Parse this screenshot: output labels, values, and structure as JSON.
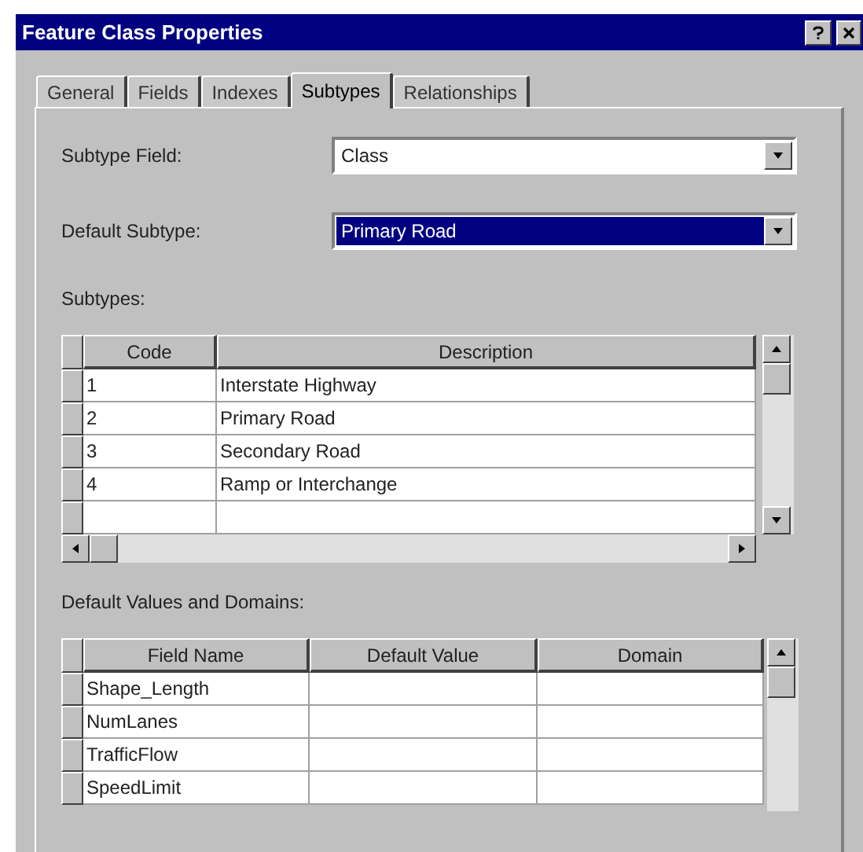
{
  "window": {
    "title": "Feature Class Properties"
  },
  "tabs": [
    {
      "label": "General",
      "selected": false
    },
    {
      "label": "Fields",
      "selected": false
    },
    {
      "label": "Indexes",
      "selected": false
    },
    {
      "label": "Subtypes",
      "selected": true
    },
    {
      "label": "Relationships",
      "selected": false
    }
  ],
  "fields": [
    {
      "label": "Subtype Field:",
      "value": "Class",
      "focused": false
    },
    {
      "label": "Default Subtype:",
      "value": "Primary Road",
      "focused": true
    }
  ],
  "subtypes": {
    "label": "Subtypes:",
    "columns": [
      "Code",
      "Description"
    ],
    "rows": [
      [
        "1",
        "Interstate Highway"
      ],
      [
        "2",
        "Primary Road"
      ],
      [
        "3",
        "Secondary Road"
      ],
      [
        "4",
        "Ramp or Interchange"
      ]
    ]
  },
  "defaults": {
    "label": "Default Values and Domains:",
    "columns": [
      "Field Name",
      "Default Value",
      "Domain"
    ],
    "rows": [
      [
        "Shape_Length"
      ],
      [
        "NumLanes"
      ],
      [
        "TrafficFlow"
      ],
      [
        "SpeedLimit"
      ]
    ]
  }
}
